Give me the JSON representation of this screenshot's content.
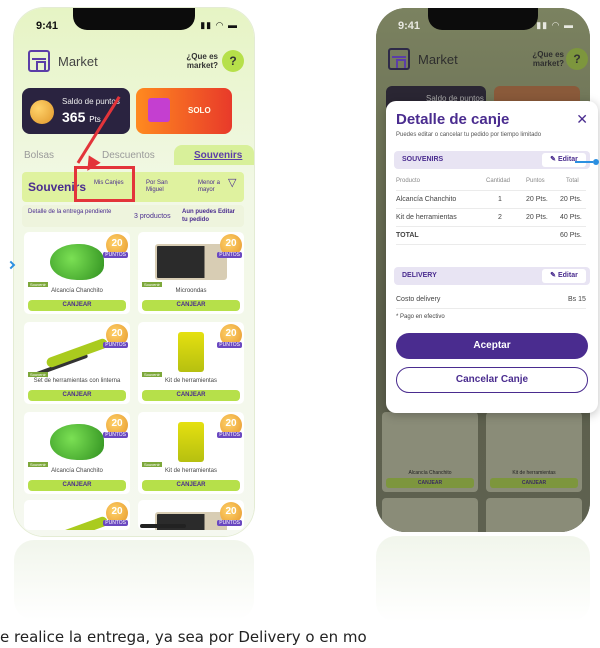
{
  "left_phone": {
    "time": "9:41",
    "header": {
      "title": "Market",
      "help_link": "¿Que es market?",
      "help_badge": "?"
    },
    "balance": {
      "label": "Saldo de puntos",
      "points": "365",
      "unit": "Pts"
    },
    "promo": {
      "text": "SOLO"
    },
    "tabs": [
      {
        "label": "Bolsas"
      },
      {
        "label": "Descuentos"
      },
      {
        "label": "Souvenirs"
      }
    ],
    "section": {
      "title": "Souvenirs",
      "filter_1": "Mis Canjes",
      "filter_2": "Por San Miguel",
      "filter_3": "Menor a mayor"
    },
    "pending": {
      "label": "Detalle de la entrega pendiente",
      "count": "3 productos",
      "hint": "Aun puedes Editar tu pedido"
    },
    "products": [
      {
        "name": "Alcancía Chanchito",
        "points": "20",
        "tag": "PUNTOS",
        "action": "CANJEAR",
        "image": "pig"
      },
      {
        "name": "Microondas",
        "points": "20",
        "tag": "PUNTOS",
        "action": "CANJEAR",
        "image": "microwave"
      },
      {
        "name": "Set de herramientas con linterna",
        "points": "20",
        "tag": "PUNTOS",
        "action": "CANJEAR",
        "image": "tool"
      },
      {
        "name": "Kit de herramientas",
        "points": "20",
        "tag": "PUNTOS",
        "action": "CANJEAR",
        "image": "kit"
      },
      {
        "name": "Alcancía Chanchito",
        "points": "20",
        "tag": "PUNTOS",
        "action": "CANJEAR",
        "image": "pig"
      },
      {
        "name": "Kit de herramientas",
        "points": "20",
        "tag": "PUNTOS",
        "action": "CANJEAR",
        "image": "kit"
      },
      {
        "name": "",
        "points": "20",
        "tag": "PUNTOS",
        "action": "",
        "image": "tool"
      },
      {
        "name": "",
        "points": "20",
        "tag": "PUNTOS",
        "action": "",
        "image": "microwave"
      }
    ]
  },
  "right_phone": {
    "time": "9:41",
    "header": {
      "title": "Market",
      "help_link": "¿Que es market?",
      "help_badge": "?"
    },
    "balance_label": "Saldo de puntos",
    "modal": {
      "title": "Detalle de canje",
      "close": "✕",
      "subtitle": "Puedes editar o cancelar tu pedido por tiempo limitado",
      "souvenirs_bar": {
        "label": "SOUVENIRS",
        "edit": "Editar"
      },
      "columns": [
        "Producto",
        "Cantidad",
        "Puntos",
        "Total"
      ],
      "rows": [
        {
          "product": "Alcancía Chanchito",
          "qty": "1",
          "points": "20 Pts.",
          "total": "20 Pts."
        },
        {
          "product": "Kit de herramientas",
          "qty": "2",
          "points": "20 Pts.",
          "total": "40 Pts."
        }
      ],
      "total_label": "TOTAL",
      "total_value": "60 Pts.",
      "delivery_bar": {
        "label": "DELIVERY",
        "edit": "Editar"
      },
      "delivery_cost_label": "Costo delivery",
      "delivery_cost_value": "Bs 15",
      "payment_note": "* Pago en efectivo",
      "accept": "Aceptar",
      "cancel": "Cancelar Canje"
    },
    "bg_products": [
      {
        "name": "Alcancía Chanchito",
        "action": "CANJEAR"
      },
      {
        "name": "Kit de herramientas",
        "action": "CANJEAR"
      }
    ]
  },
  "caption": "e realice la entrega, ya sea por Delivery o en mo",
  "colors": {
    "brand_purple": "#4a2c8f",
    "lime": "#b6e04a",
    "highlight_red": "#e3343a"
  }
}
